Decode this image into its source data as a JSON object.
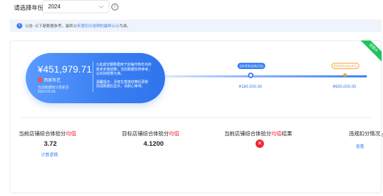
{
  "filter": {
    "label": "请选择年份:",
    "year": "2024",
    "info_icon": "info-circle-icon"
  },
  "notice": {
    "icon": "info-filled-icon",
    "text_prefix": "公告: 以下是数据参考，最终以",
    "link": "年度扣分说明的最终公示",
    "text_suffix": "为准。"
  },
  "summary": {
    "amount": "¥451,979.71",
    "store_name": "西家布艺",
    "update_line1": "当前数据统计更新至",
    "update_line2": "2024-05-09",
    "desc_lines": [
      "①此成交额数据用于店铺归档年内的",
      "技术年度结算，当前数据仅供参考，",
      "以实际结算为准。"
    ],
    "tip_lines": [
      "温馨提示：月度在季度结算后更新",
      "完成数据后显示，请耐心等待。"
    ],
    "ribbon": "运营中"
  },
  "progress": {
    "current_label": "当年目标达成(已达)",
    "current_value": "¥180,000.00",
    "next_label": "更高目标达成(未达)",
    "next_value": "¥600,000.00",
    "fraction": 0.3
  },
  "metrics": {
    "m1_label_pre": "当前店铺综合体验分",
    "m1_label_red": "均值",
    "m1_value": "3.72",
    "m1_link": "计算逻辑",
    "m2_label_pre": "目标店铺综合体验分",
    "m2_label_red": "均值",
    "m2_value": "4.1200",
    "m3_label_pre": "当前店铺综合体验分",
    "m3_label_red": "均值",
    "m3_label_post": "结果",
    "m3_result_icon": "close-circle-icon",
    "m4_label": "违规扣分情况",
    "m4_link": "查看"
  },
  "colors": {
    "primary": "#3a80f3",
    "danger": "#f5222d",
    "warning": "#f6a13a",
    "success": "#22c35d"
  }
}
